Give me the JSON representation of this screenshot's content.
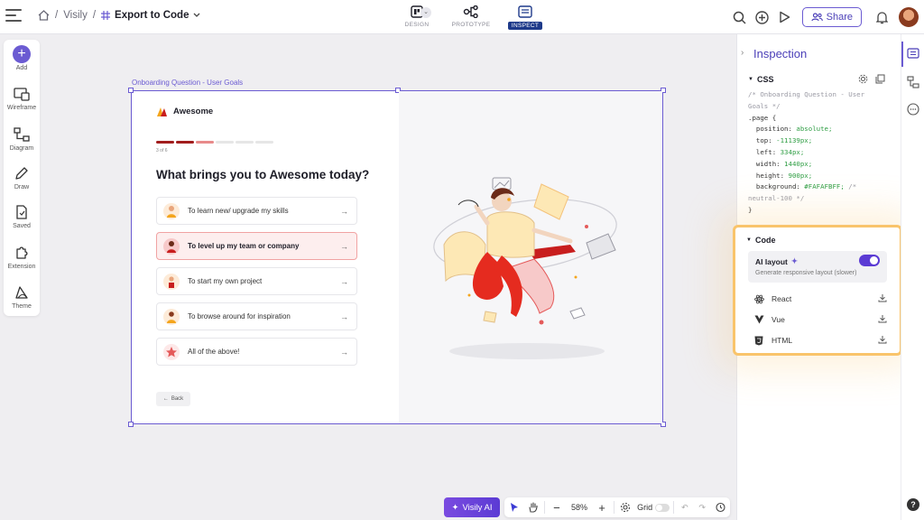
{
  "breadcrumb": {
    "root": "Visily",
    "separator": "/",
    "current": "Export to Code"
  },
  "modes": [
    {
      "label": "DESIGN",
      "active": false
    },
    {
      "label": "PROTOTYPE",
      "active": false
    },
    {
      "label": "INSPECT",
      "active": true
    }
  ],
  "topbar": {
    "share_label": "Share"
  },
  "leftbar": {
    "items": [
      {
        "label": "Add",
        "icon": "plus-icon"
      },
      {
        "label": "Wireframe",
        "icon": "wireframe-icon"
      },
      {
        "label": "Diagram",
        "icon": "diagram-icon"
      },
      {
        "label": "Draw",
        "icon": "pen-icon"
      },
      {
        "label": "Saved",
        "icon": "saved-icon"
      },
      {
        "label": "Extension",
        "icon": "puzzle-icon"
      },
      {
        "label": "Theme",
        "icon": "theme-icon"
      }
    ]
  },
  "canvas": {
    "frame_label": "Onboarding Question - User Goals",
    "brand_name": "Awesome",
    "step_text": "3 of 6",
    "progress": {
      "completed": 2,
      "current": 3,
      "total": 6
    },
    "question": "What brings you to Awesome today?",
    "options": [
      {
        "label": "To learn new/ upgrade my skills",
        "selected": false
      },
      {
        "label": "To level up my team or company",
        "selected": true
      },
      {
        "label": "To start my own project",
        "selected": false
      },
      {
        "label": "To browse around for inspiration",
        "selected": false
      },
      {
        "label": "All of the above!",
        "selected": false
      }
    ],
    "back_label": "Back",
    "accent": "#a11d1d"
  },
  "bottombar": {
    "ai_label": "Visily AI",
    "zoom": "58%",
    "grid_label": "Grid",
    "grid_on": false
  },
  "inspection": {
    "title": "Inspection",
    "css_heading": "CSS",
    "css_lines": [
      {
        "text": "/* Onboarding Question - User",
        "kind": "comment"
      },
      {
        "text": "Goals */",
        "kind": "comment"
      },
      {
        "text": ".page {",
        "kind": "plain"
      },
      {
        "text": "  position: ",
        "value": "absolute;",
        "kind": "prop"
      },
      {
        "text": "  top: ",
        "value": "-11139px;",
        "kind": "prop"
      },
      {
        "text": "  left: ",
        "value": "334px;",
        "kind": "prop"
      },
      {
        "text": "  width: ",
        "value": "1440px;",
        "kind": "prop"
      },
      {
        "text": "  height: ",
        "value": "900px;",
        "kind": "prop"
      },
      {
        "text": "  background: ",
        "value": "#FAFAFBFF;",
        "extra": " /*",
        "kind": "prop"
      },
      {
        "text": "neutral-100 */",
        "kind": "comment"
      },
      {
        "text": "}",
        "kind": "plain"
      }
    ],
    "code_heading": "Code",
    "ai_layout_title": "AI layout",
    "ai_layout_sub": "Generate responsive layout (slower)",
    "ai_layout_on": true,
    "frameworks": [
      {
        "label": "React",
        "icon": "react-icon"
      },
      {
        "label": "Vue",
        "icon": "vue-icon"
      },
      {
        "label": "HTML",
        "icon": "html5-icon"
      }
    ],
    "highlight_color": "#f9c46b"
  },
  "colors": {
    "brand_purple": "#6b5bd2",
    "inspect_blue": "#1e3a8a"
  }
}
